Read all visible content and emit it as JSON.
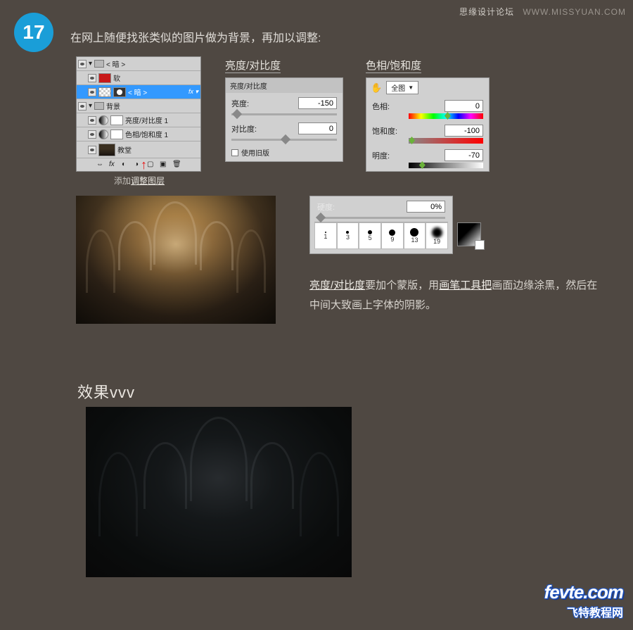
{
  "watermark_top": {
    "cn": "思缘设计论坛",
    "url": "WWW.MISSYUAN.COM"
  },
  "step": {
    "number": "17",
    "text": "在网上随便找张类似的图片做为背景，再加以调整:"
  },
  "layers": {
    "group1": "< 暗 >",
    "layer_soft": "软",
    "layer_dark_sel": "< 暗 >",
    "group_bg": "背景",
    "adj_bc": "亮度/对比度 1",
    "adj_hsl": "色相/饱和度 1",
    "layer_cathedral": "教堂"
  },
  "add_adjustment": {
    "p1": "添加",
    "p2": "调整图层"
  },
  "brightness": {
    "title": "亮度/对比度",
    "header": "亮度/对比度",
    "label_brightness": "亮度:",
    "val_brightness": "-150",
    "label_contrast": "对比度:",
    "val_contrast": "0",
    "legacy": "使用旧版"
  },
  "hue": {
    "title": "色相/饱和度",
    "preset": "全图",
    "label_hue": "色相:",
    "val_hue": "0",
    "label_sat": "饱和度:",
    "val_sat": "-100",
    "label_light": "明度:",
    "val_light": "-70"
  },
  "brush": {
    "hardness_label": "硬度:",
    "hardness_value": "0%",
    "presets": [
      "1",
      "3",
      "5",
      "9",
      "13",
      "19"
    ]
  },
  "paragraph": {
    "u1": "亮度/对比度",
    "t1": "要加个蒙版，用",
    "u2": "画笔工具把",
    "t2": "画面边缘涂黑，然后在中间大致画上字体的阴影。"
  },
  "result_title": "效果vvv",
  "watermark_bottom": {
    "big": "fevte.com",
    "cn": "飞特教程网"
  }
}
